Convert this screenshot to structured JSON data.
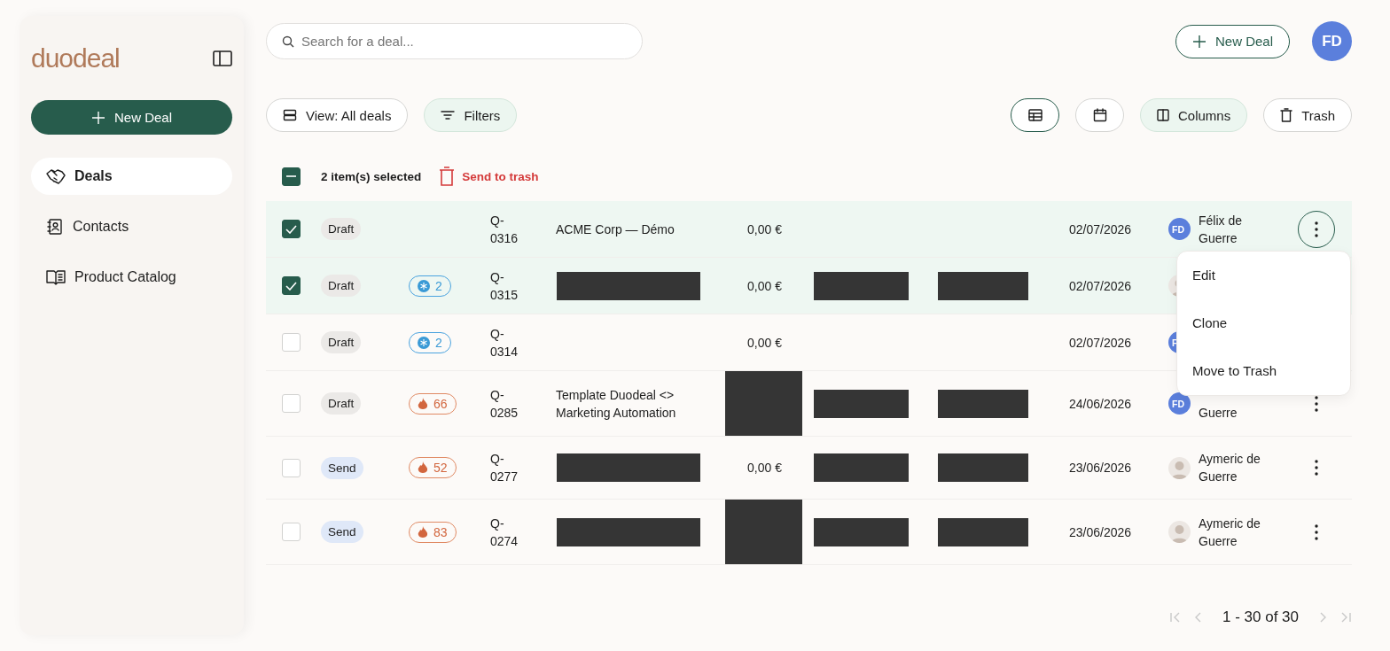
{
  "sidebar": {
    "logo": "duodeal",
    "new_deal": "New Deal",
    "items": [
      {
        "label": "Deals",
        "selected": true
      },
      {
        "label": "Contacts",
        "selected": false
      },
      {
        "label": "Product Catalog",
        "selected": false
      }
    ]
  },
  "search": {
    "placeholder": "Search for a deal..."
  },
  "header": {
    "new_deal": "New Deal",
    "user_initials": "FD"
  },
  "toolbar": {
    "view": "View: All deals",
    "filters": "Filters",
    "views": [
      {
        "selected": true
      },
      {
        "selected": false
      }
    ],
    "columns": "Columns",
    "trash": "Trash"
  },
  "selection": {
    "indeterminate": true,
    "label": "2 item(s) selected",
    "action": "Send to trash"
  },
  "rows": [
    {
      "selected": true,
      "status": {
        "label": "Draft",
        "kind": "draft"
      },
      "ref": "Q-\n0316",
      "name": "ACME Corp — Démo",
      "amount": "0,00 €",
      "date": "02/07/2026",
      "owner": {
        "kind": "initials",
        "initials": "FD",
        "name": "Félix de\nGuerre"
      },
      "menu_open": true
    },
    {
      "selected": true,
      "status": {
        "label": "Draft",
        "kind": "draft"
      },
      "score": {
        "kind": "cold",
        "value": "2"
      },
      "ref": "Q-\n0315",
      "name_redacted": true,
      "amount": "0,00 €",
      "column_7_redacted": true,
      "column_8_redacted": true,
      "date": "02/07/2026",
      "owner": {
        "kind": "photo"
      }
    },
    {
      "selected": false,
      "status": {
        "label": "Draft",
        "kind": "draft"
      },
      "score": {
        "kind": "cold",
        "value": "2"
      },
      "ref": "Q-\n0314",
      "amount": "0,00 €",
      "date": "02/07/2026",
      "owner": {
        "kind": "initials",
        "initials": "F"
      }
    },
    {
      "selected": false,
      "status": {
        "label": "Draft",
        "kind": "draft"
      },
      "score": {
        "kind": "hot",
        "value": "66"
      },
      "ref": "Q-\n0285",
      "name": "Template Duodeal <>\nMarketing Automation",
      "amount_redacted": true,
      "column_7_redacted": true,
      "column_8_redacted": true,
      "date": "24/06/2026",
      "owner": {
        "kind": "initials",
        "initials": "FD",
        "name": "Guerre"
      },
      "menu_open": false
    },
    {
      "selected": false,
      "status": {
        "label": "Send",
        "kind": "send"
      },
      "score": {
        "kind": "hot",
        "value": "52"
      },
      "ref": "Q-\n0277",
      "name_redacted": true,
      "amount": "0,00 €",
      "column_7_redacted": true,
      "column_8_redacted": true,
      "date": "23/06/2026",
      "owner": {
        "kind": "photo",
        "name": "Aymeric de\nGuerre"
      },
      "menu_open": false
    },
    {
      "selected": false,
      "status": {
        "label": "Send",
        "kind": "send"
      },
      "score": {
        "kind": "hot",
        "value": "83"
      },
      "ref": "Q-\n0274",
      "name_redacted": true,
      "amount_redacted": true,
      "column_7_redacted": true,
      "column_8_redacted": true,
      "date": "23/06/2026",
      "owner": {
        "kind": "photo",
        "name": "Aymeric de\nGuerre"
      },
      "menu_open": false
    }
  ],
  "row_menu": [
    "Edit",
    "Clone",
    "Move to Trash"
  ],
  "pagination": {
    "range": "1 - 30 of 30"
  }
}
